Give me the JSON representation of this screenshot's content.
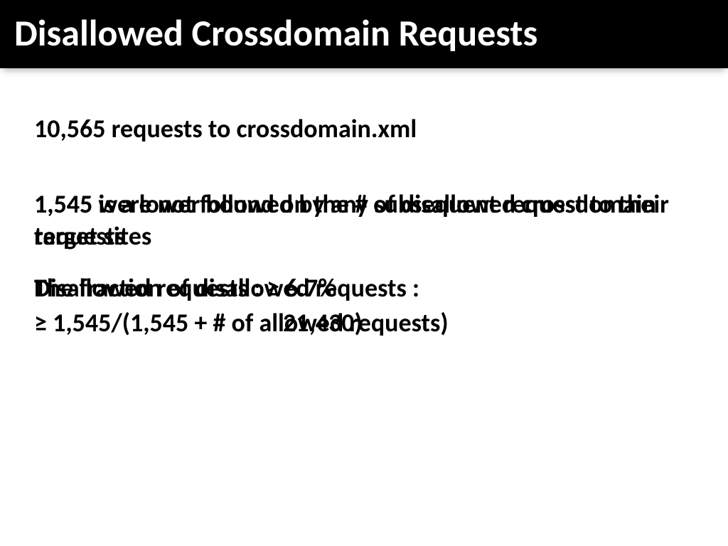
{
  "title": "Disallowed Crossdomain Requests",
  "line1": "10,565 requests to crossdomain.xml",
  "layerA": {
    "p1": "1,545 were not followed by any subsequent request to their target sites",
    "p2": "Disallowed requests : ≥ 6.7%",
    "p3": "21,430)"
  },
  "layerB": {
    "p1": "1,545 is a lower bound on the # of disallowed crossdomain requests",
    "p2": "The fraction of disallowed requests :",
    "p3": "≥ 1,545/(1,545 + # of allowed requests)"
  }
}
